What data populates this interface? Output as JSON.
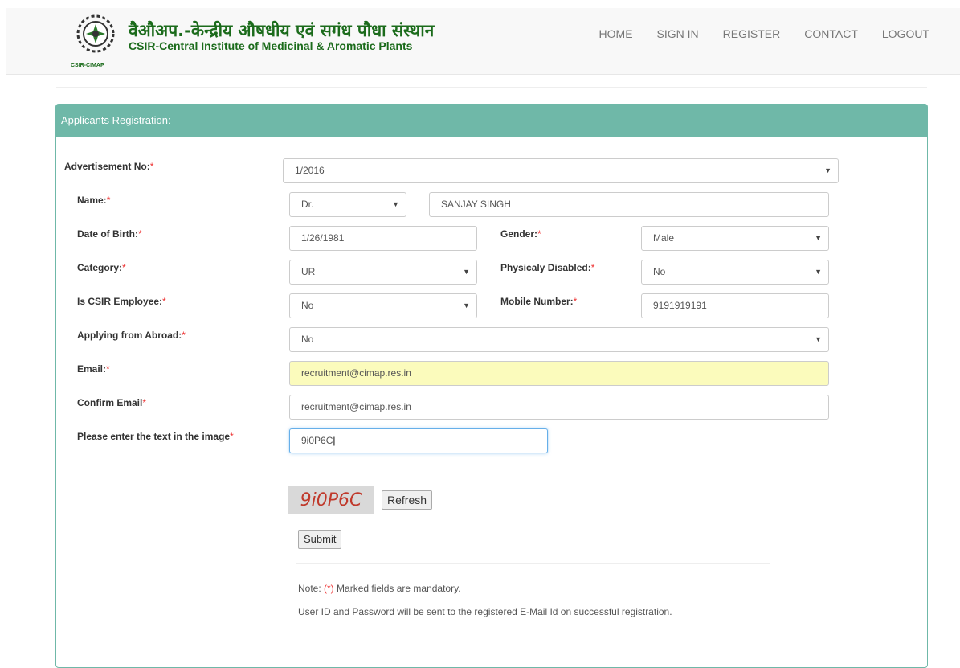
{
  "header": {
    "logo_text": "CSIR-CIMAP",
    "title_hi": "वैऔअप.-केन्द्रीय औषधीय एवं सगंध पौधा संस्थान",
    "title_en": "CSIR-Central Institute of Medicinal & Aromatic Plants",
    "nav": [
      "HOME",
      "SIGN IN",
      "REGISTER",
      "CONTACT",
      "LOGOUT"
    ]
  },
  "panel": {
    "title": "Applicants Registration:"
  },
  "form": {
    "advertisement": {
      "label": "Advertisement No:",
      "value": "1/2016"
    },
    "name": {
      "label": "Name:",
      "salutation": "Dr.",
      "value": "SANJAY SINGH"
    },
    "dob": {
      "label": "Date of Birth:",
      "value": "1/26/1981"
    },
    "gender": {
      "label": "Gender:",
      "value": "Male"
    },
    "category": {
      "label": "Category:",
      "value": "UR"
    },
    "disabled": {
      "label": "Physicaly Disabled:",
      "value": "No"
    },
    "csir_employee": {
      "label": "Is CSIR Employee:",
      "value": "No"
    },
    "mobile": {
      "label": "Mobile Number:",
      "value": "9191919191"
    },
    "abroad": {
      "label": "Applying from Abroad:",
      "value": "No"
    },
    "email": {
      "label": "Email:",
      "value": "recruitment@cimap.res.in"
    },
    "confirm_email": {
      "label": "Confirm Email",
      "value": "recruitment@cimap.res.in"
    },
    "captcha_input": {
      "label": "Please enter the text in the image",
      "value": "9i0P6C"
    },
    "captcha_image_text": "9i0P6C",
    "refresh_label": "Refresh",
    "submit_label": "Submit",
    "required_mark": "*"
  },
  "notes": {
    "note_prefix": "Note: ",
    "note_mark": "(*)",
    "note_rest": " Marked fields are mandatory.",
    "info": "User ID and Password will be sent to the registered E-Mail Id on successful registration."
  },
  "colors": {
    "brand_green": "#1b6b1b",
    "panel_teal": "#6fb8a8",
    "highlight": "#fbfbbc"
  }
}
